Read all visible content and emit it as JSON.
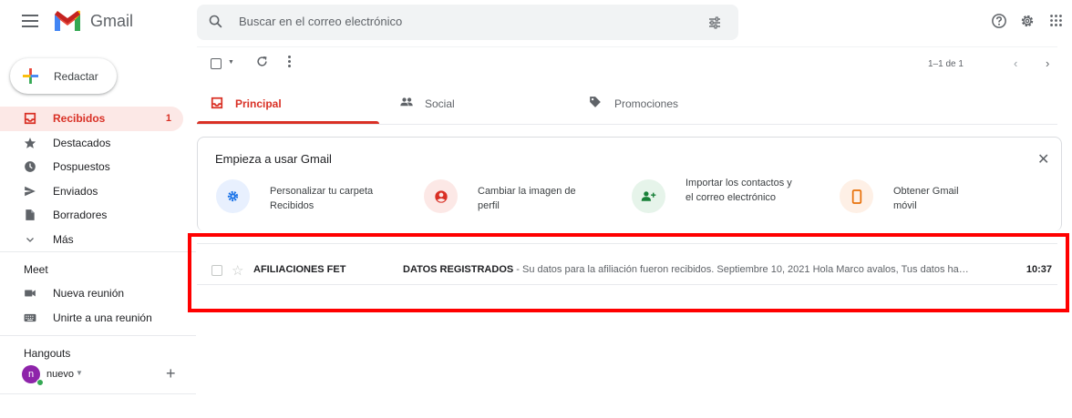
{
  "header": {
    "app_name": "Gmail",
    "search_placeholder": "Buscar en el correo electrónico"
  },
  "compose": {
    "label": "Redactar"
  },
  "nav": {
    "items": [
      {
        "label": "Recibidos",
        "count": "1",
        "icon": "inbox-icon",
        "active": true
      },
      {
        "label": "Destacados",
        "icon": "star-icon"
      },
      {
        "label": "Pospuestos",
        "icon": "clock-icon"
      },
      {
        "label": "Enviados",
        "icon": "send-icon"
      },
      {
        "label": "Borradores",
        "icon": "draft-icon"
      },
      {
        "label": "Más",
        "icon": "chevron-down-icon"
      }
    ]
  },
  "meet": {
    "title": "Meet",
    "new_meeting": "Nueva reunión",
    "join_meeting": "Unirte a una reunión"
  },
  "hangouts": {
    "title": "Hangouts",
    "avatar_letter": "n",
    "user": "nuevo"
  },
  "toolbar": {
    "pager": "1–1 de 1"
  },
  "tabs": [
    {
      "label": "Principal",
      "active": true
    },
    {
      "label": "Social"
    },
    {
      "label": "Promociones"
    }
  ],
  "onboarding": {
    "title": "Empieza a usar Gmail",
    "items": [
      {
        "text": "Personalizar tu carpeta Recibidos"
      },
      {
        "text": "Cambiar la imagen de perfil"
      },
      {
        "text": "Importar los contactos y el correo electrónico"
      },
      {
        "text": "Obtener Gmail móvil"
      }
    ]
  },
  "emails": [
    {
      "sender": "AFILIACIONES FET",
      "subject": "DATOS REGISTRADOS",
      "snippet": " - Su datos para la afiliación fueron recibidos. Septiembre 10, 2021 Hola Marco avalos, Tus datos han sido registrados correctamente.",
      "time": "10:37"
    }
  ],
  "colors": {
    "accent": "#d93025",
    "highlight": "#ff0000"
  }
}
